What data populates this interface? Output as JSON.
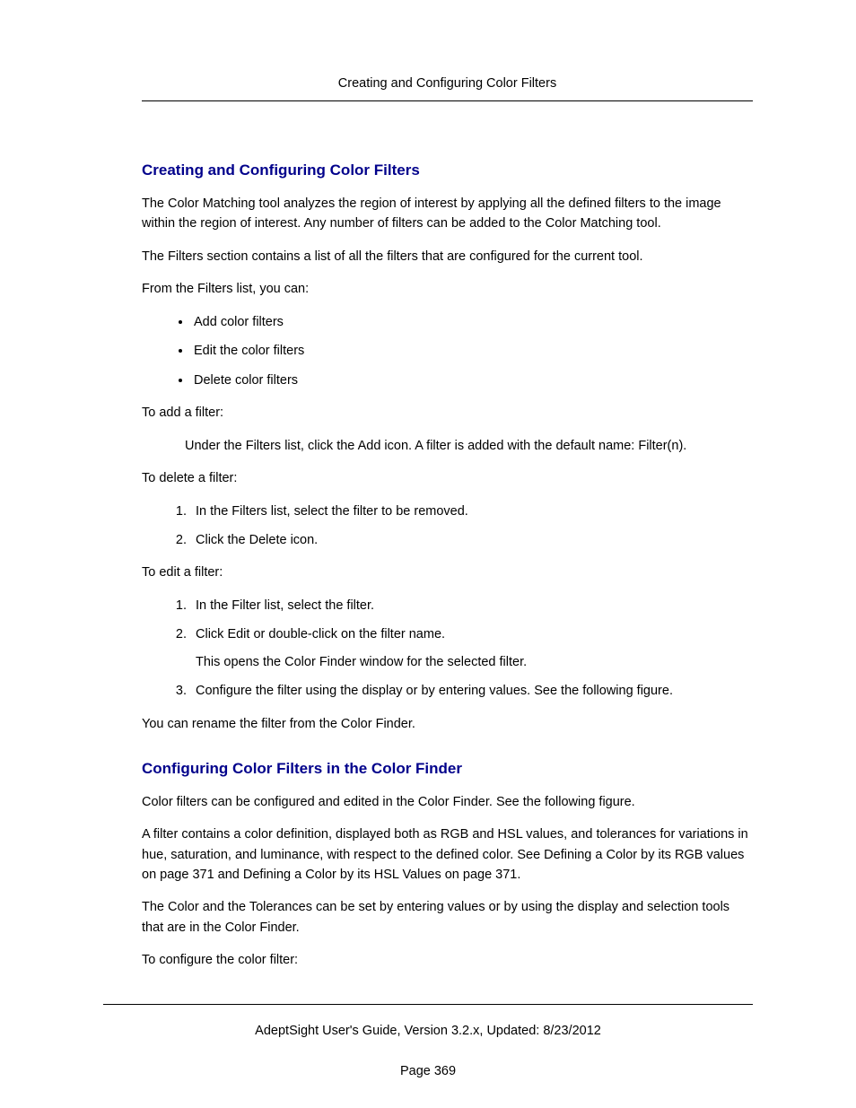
{
  "header": {
    "running_title": "Creating and Configuring Color Filters"
  },
  "section1": {
    "heading": "Creating and Configuring Color Filters",
    "p1": "The Color Matching tool analyzes the region of interest by applying all the defined filters to the image within the region of interest. Any number of filters can be added to the Color Matching tool.",
    "p2": "The Filters section contains a list of all the filters that are configured for the current tool.",
    "p3": "From the Filters list, you can:",
    "bullets": {
      "b0": "Add color filters",
      "b1": "Edit the color filters",
      "b2": "Delete color filters"
    },
    "add_intro": "To add a filter:",
    "add_text": "Under the Filters list, click the Add icon. A filter is added with the default name: Filter(n).",
    "delete_intro": "To delete a filter:",
    "delete_steps": {
      "s0": "In the Filters list, select the filter to be removed.",
      "s1": "Click the Delete icon."
    },
    "edit_intro": "To edit a filter:",
    "edit_steps": {
      "s0": "In the Filter list, select the filter.",
      "s1": "Click Edit or double-click on the filter name.",
      "s1_sub": "This opens the Color Finder window for the selected filter.",
      "s2": "Configure the filter using the display or by entering values. See the following figure."
    },
    "rename": "You can rename the filter from the Color Finder."
  },
  "section2": {
    "heading": "Configuring Color Filters in the Color Finder",
    "p1": "Color filters can be configured and edited in the Color Finder. See the following figure.",
    "p2": "A filter contains a color definition, displayed both as RGB and HSL values, and tolerances for variations in hue, saturation, and luminance, with respect to the defined color. See Defining a Color by its RGB values on page 371 and Defining a Color by its HSL Values on page 371.",
    "p3": "The Color and the Tolerances can be set by entering values or by using the display and selection tools that are in the Color Finder.",
    "p4": "To configure the color filter:"
  },
  "footer": {
    "line1": "AdeptSight User's Guide,  Version 3.2.x, Updated: 8/23/2012",
    "line2": "Page 369"
  }
}
